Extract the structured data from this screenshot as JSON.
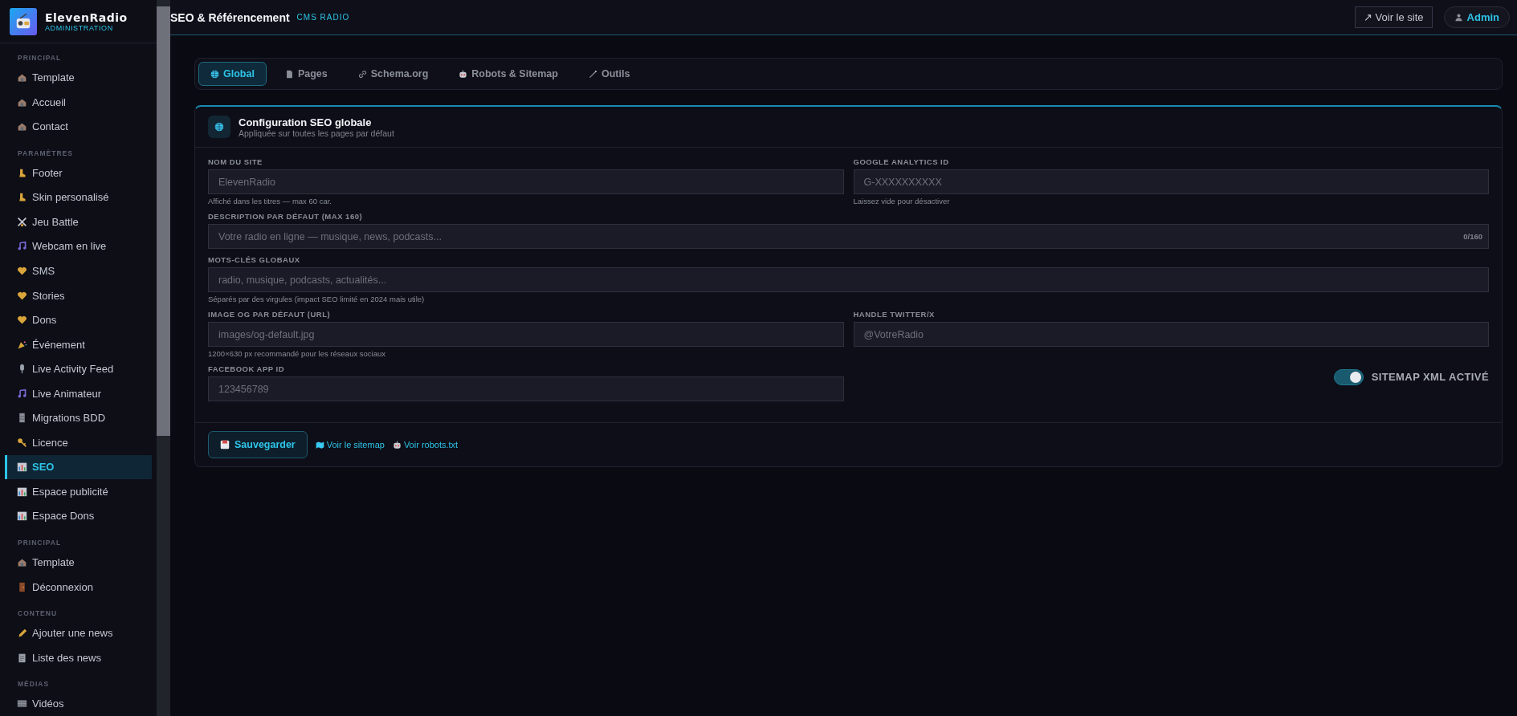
{
  "sidebar": {
    "brand": {
      "name": "ElevenRadio",
      "subtitle": "ADMINISTRATION"
    },
    "sections": [
      {
        "title": "PRINCIPAL",
        "items": [
          {
            "label": "Template",
            "kind": "house",
            "selected": false
          },
          {
            "label": "Accueil",
            "kind": "house",
            "selected": false
          },
          {
            "label": "Contact",
            "kind": "house",
            "selected": false
          }
        ]
      },
      {
        "title": "PARAMÈTRES",
        "items": [
          {
            "label": "Footer",
            "kind": "foot",
            "selected": false
          },
          {
            "label": "Skin personalisé",
            "kind": "foot",
            "selected": false
          },
          {
            "label": "Jeu Battle",
            "kind": "swords",
            "selected": false
          },
          {
            "label": "Webcam en live",
            "kind": "note",
            "selected": false
          },
          {
            "label": "SMS",
            "kind": "heart",
            "selected": false
          },
          {
            "label": "Stories",
            "kind": "heart",
            "selected": false
          },
          {
            "label": "Dons",
            "kind": "heart",
            "selected": false
          },
          {
            "label": "Événement",
            "kind": "party",
            "selected": false
          },
          {
            "label": "Live Activity Feed",
            "kind": "mic",
            "selected": false
          },
          {
            "label": "Live Animateur",
            "kind": "note",
            "selected": false
          },
          {
            "label": "Migrations BDD",
            "kind": "cabinet",
            "selected": false
          },
          {
            "label": "Licence",
            "kind": "key",
            "selected": false
          },
          {
            "label": "SEO",
            "kind": "chart",
            "selected": true
          },
          {
            "label": "Espace publicité",
            "kind": "chart",
            "selected": false
          },
          {
            "label": "Espace Dons",
            "kind": "chart",
            "selected": false
          }
        ]
      },
      {
        "title": "PRINCIPAL",
        "items": [
          {
            "label": "Template",
            "kind": "house",
            "selected": false
          },
          {
            "label": "Déconnexion",
            "kind": "door",
            "selected": false
          }
        ]
      },
      {
        "title": "CONTENU",
        "items": [
          {
            "label": "Ajouter une news",
            "kind": "pencil",
            "selected": false
          },
          {
            "label": "Liste des news",
            "kind": "clipboard",
            "selected": false
          }
        ]
      },
      {
        "title": "MÉDIAS",
        "items": [
          {
            "label": "Vidéos",
            "kind": "film",
            "selected": false
          }
        ]
      }
    ]
  },
  "header": {
    "title": "SEO & Référencement",
    "tag": "CMS RADIO",
    "view_site": "↗ Voir le site",
    "user": "Admin"
  },
  "tabs": [
    {
      "label": "Global",
      "kind": "globe",
      "selected": true
    },
    {
      "label": "Pages",
      "kind": "page",
      "selected": false
    },
    {
      "label": "Schema.org",
      "kind": "link",
      "selected": false
    },
    {
      "label": "Robots & Sitemap",
      "kind": "robot",
      "selected": false
    },
    {
      "label": "Outils",
      "kind": "wand",
      "selected": false
    }
  ],
  "card": {
    "title": "Configuration SEO globale",
    "subtitle": "Appliquée sur toutes les pages par défaut",
    "rows": [
      [
        {
          "kind": "text",
          "label": "NOM DU SITE",
          "placeholder": "ElevenRadio",
          "hint": "Affiché dans les titres — max 60 car."
        },
        {
          "kind": "text",
          "label": "GOOGLE ANALYTICS ID",
          "placeholder": "G-XXXXXXXXXX",
          "hint": "Laissez vide pour désactiver"
        }
      ],
      [
        {
          "kind": "text",
          "label": "DESCRIPTION PAR DÉFAUT (MAX 160)",
          "placeholder": "Votre radio en ligne — musique, news, podcasts...",
          "counter": "0/160"
        }
      ],
      [
        {
          "kind": "text",
          "label": "MOTS-CLÉS GLOBAUX",
          "placeholder": "radio, musique, podcasts, actualités...",
          "hint": "Séparés par des virgules (impact SEO limité en 2024 mais utile)"
        }
      ],
      [
        {
          "kind": "text",
          "label": "IMAGE OG PAR DÉFAUT (URL)",
          "placeholder": "images/og-default.jpg",
          "hint": "1200×630 px recommandé pour les réseaux sociaux"
        },
        {
          "kind": "text",
          "label": "HANDLE TWITTER/X",
          "placeholder": "@VotreRadio"
        }
      ],
      [
        {
          "kind": "text",
          "label": "FACEBOOK APP ID",
          "placeholder": "123456789"
        },
        {
          "kind": "toggle",
          "label": "SITEMAP XML ACTIVÉ",
          "on": true
        }
      ]
    ],
    "save": "Sauvegarder",
    "links": [
      {
        "label": "Voir le sitemap",
        "kind": "map"
      },
      {
        "label": "Voir robots.txt",
        "kind": "robot"
      }
    ]
  }
}
